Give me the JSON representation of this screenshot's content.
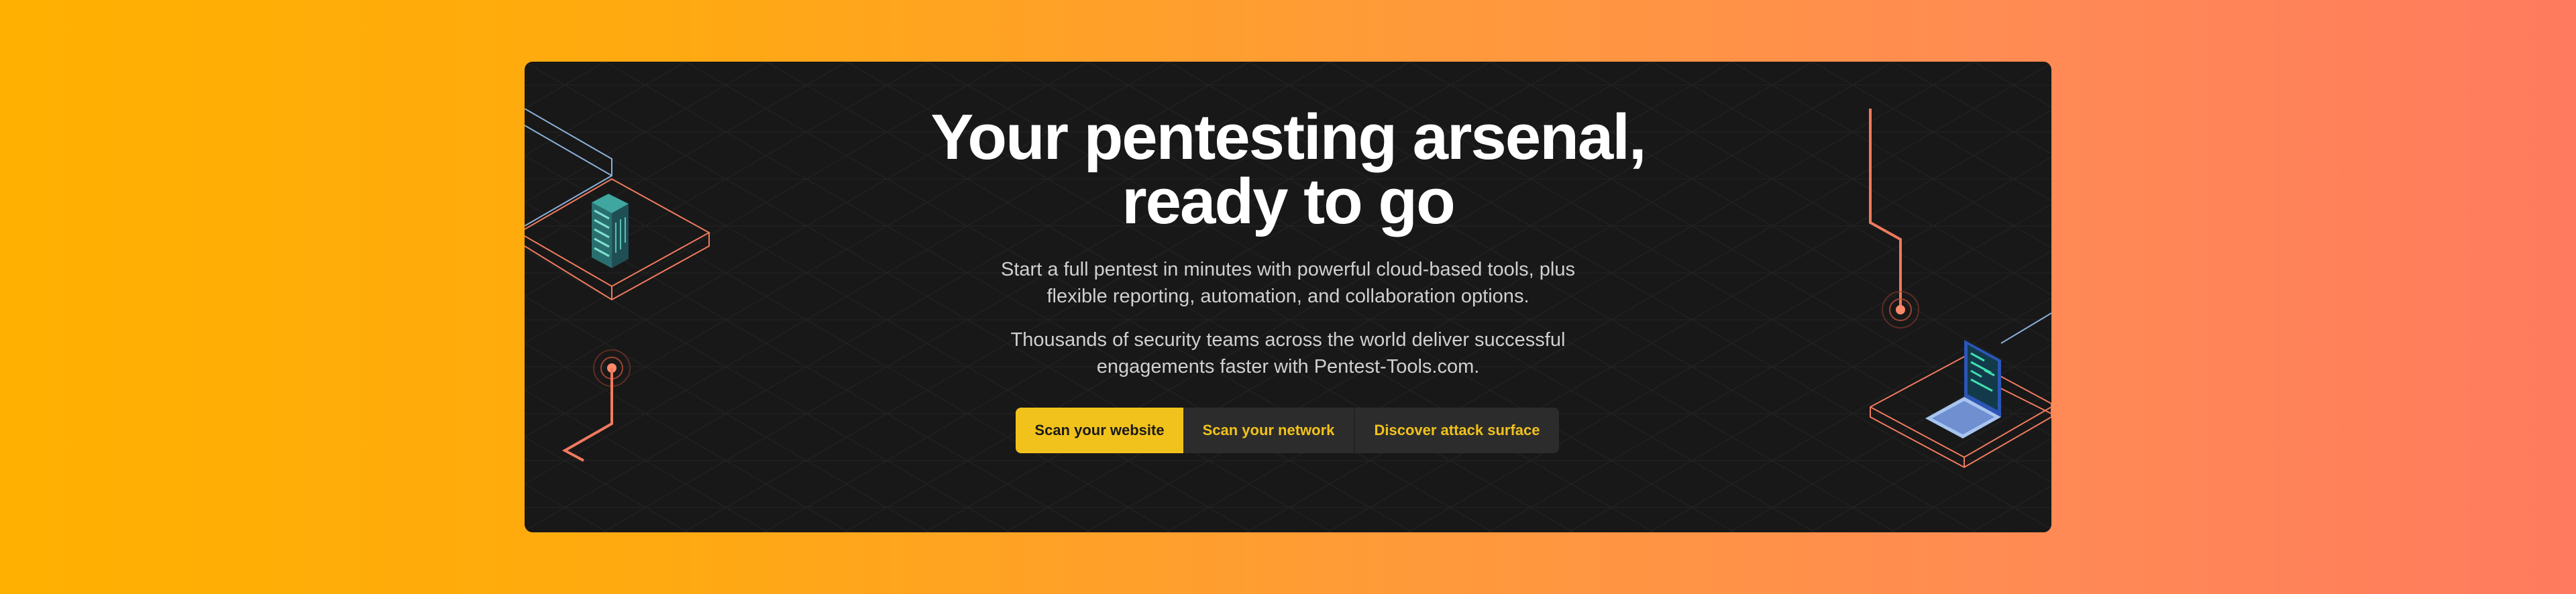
{
  "hero": {
    "title_line1": "Your pentesting arsenal,",
    "title_line2": "ready to go",
    "para1_line1": "Start a full pentest in minutes with powerful cloud-based tools, plus",
    "para1_line2": "flexible reporting, automation, and collaboration options.",
    "para2_line1": "Thousands of security teams across the world deliver successful",
    "para2_line2": "engagements faster with Pentest-Tools.com."
  },
  "buttons": {
    "scan_website": "Scan your website",
    "scan_network": "Scan your network",
    "attack_surface": "Discover attack surface"
  },
  "colors": {
    "accent": "#f1c21b",
    "card_bg": "#181818",
    "line_orange": "#f07a5e",
    "line_blue": "#8ab0d8"
  },
  "icons": {
    "server": "server-icon",
    "laptop": "laptop-icon",
    "signal_left": "signal-pulse-icon",
    "signal_right": "signal-pulse-icon"
  }
}
